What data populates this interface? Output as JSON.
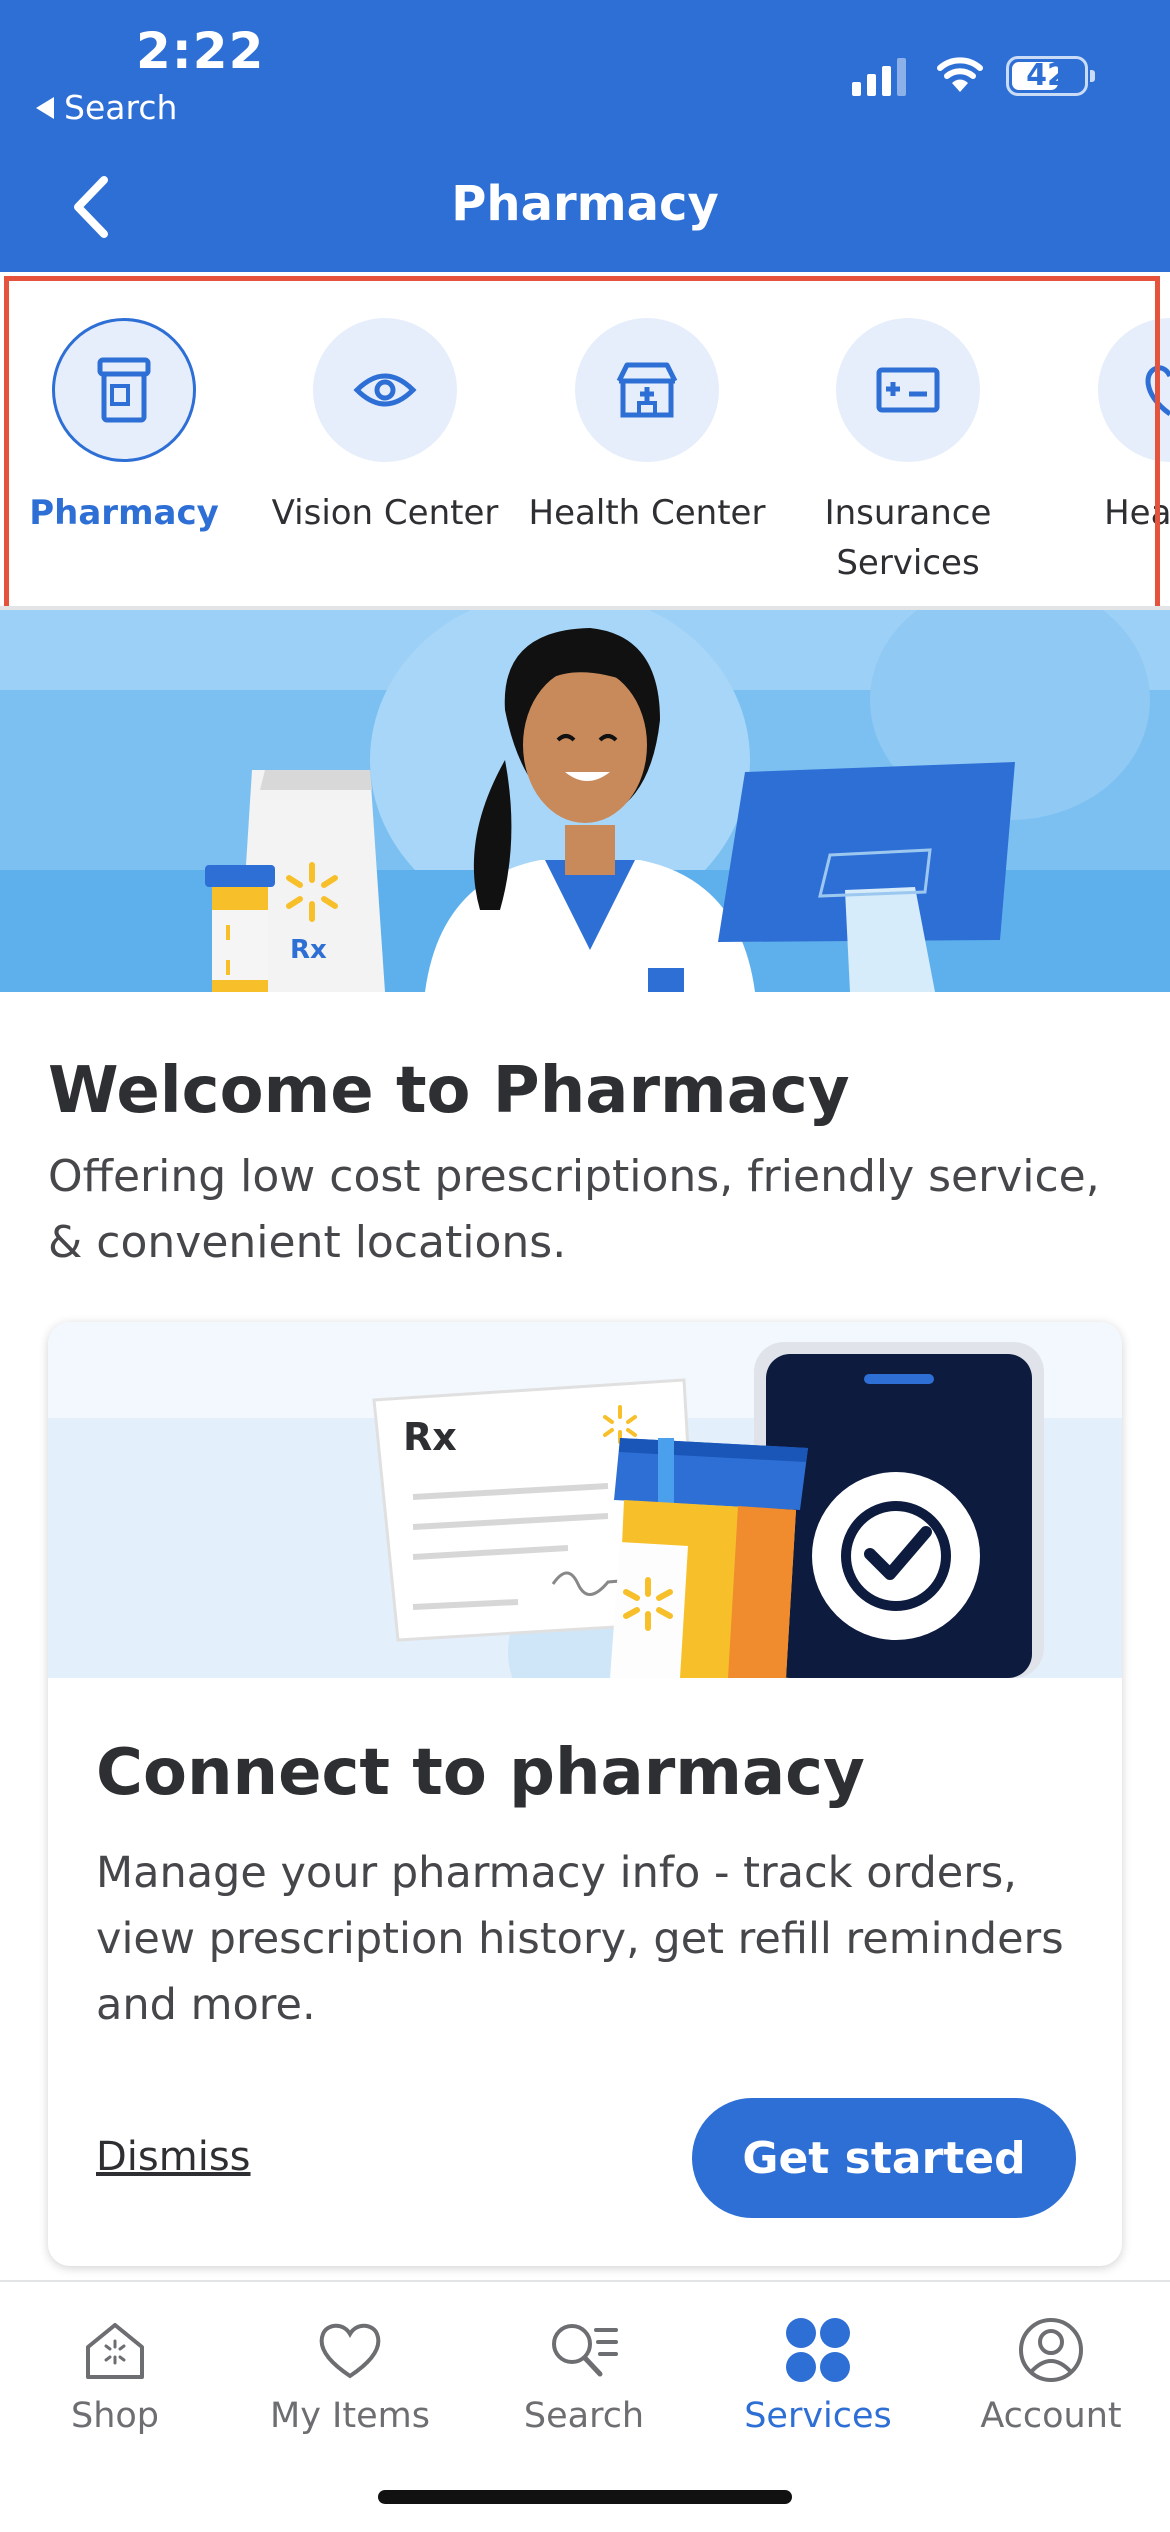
{
  "status_bar": {
    "time": "2:22",
    "back_app_label": "Search",
    "battery": "42"
  },
  "header": {
    "title": "Pharmacy"
  },
  "category_tabs": [
    {
      "label": "Pharmacy",
      "icon": "pill-bottle-icon",
      "active": true
    },
    {
      "label": "Vision Center",
      "icon": "eye-icon",
      "active": false
    },
    {
      "label": "Health Center",
      "icon": "clinic-icon",
      "active": false
    },
    {
      "label": "Insurance Services",
      "icon": "insurance-card-icon",
      "active": false
    },
    {
      "label": "Healthy",
      "icon": "healthy-icon",
      "active": false
    }
  ],
  "hero": {
    "rx_label": "Rx"
  },
  "welcome": {
    "title": "Welcome to Pharmacy",
    "subtitle": "Offering low cost prescriptions, friendly service, & convenient locations."
  },
  "connect_card": {
    "rx_label": "Rx",
    "title": "Connect to pharmacy",
    "description": "Manage your pharmacy info - track orders, view prescription history, get refill reminders and more.",
    "dismiss_label": "Dismiss",
    "cta_label": "Get started"
  },
  "bottom_nav": [
    {
      "label": "Shop",
      "icon": "shop-icon",
      "active": false
    },
    {
      "label": "My Items",
      "icon": "heart-icon",
      "active": false
    },
    {
      "label": "Search",
      "icon": "search-list-icon",
      "active": false
    },
    {
      "label": "Services",
      "icon": "services-icon",
      "active": true
    },
    {
      "label": "Account",
      "icon": "account-icon",
      "active": false
    }
  ],
  "colors": {
    "brand_blue": "#2e6fd6",
    "highlight": "#e5533d",
    "spark_yellow": "#f7c02b"
  }
}
